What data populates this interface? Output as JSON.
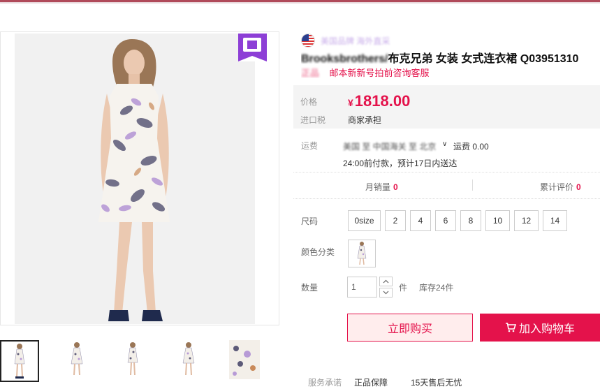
{
  "gallery": {
    "main_image_alt": "",
    "thumbnail_count": 5,
    "active_thumbnail": 0
  },
  "product": {
    "origin_text": "美国品牌 海外直采",
    "title_brand_blurred": "Brooksbrothers/",
    "title_rest": "布克兄弟 女装 女式连衣裙 Q03951310",
    "subtitle_blurred": "正品",
    "subtitle_rest": "邮本新新号拍前咨询客服"
  },
  "price": {
    "label": "价格",
    "currency": "¥",
    "value": "1818.00",
    "tax_label": "进口税",
    "tax_value": "商家承担"
  },
  "shipping": {
    "label": "运费",
    "from_text": "美国 至 中国海关 至 北京",
    "chevron": "∨",
    "fee_text": "运费 0.00",
    "note": "24:00前付款，预计17日内送达"
  },
  "stats": {
    "monthly_label": "月销量",
    "monthly_value": "0",
    "rating_label": "累计评价",
    "rating_value": "0"
  },
  "sizes": {
    "label": "尺码",
    "options": [
      "0size",
      "2",
      "4",
      "6",
      "8",
      "10",
      "12",
      "14"
    ]
  },
  "color": {
    "label": "颜色分类"
  },
  "quantity": {
    "label": "数量",
    "value": "1",
    "unit": "件",
    "stock": "库存24件"
  },
  "actions": {
    "buy_now": "立即购买",
    "add_cart": "加入购物车"
  },
  "service": {
    "label": "服务承诺",
    "item1": "正品保障",
    "item2": "15天售后无忧"
  },
  "colors": {
    "accent": "#e4124b",
    "badge": "#8d3fd6",
    "price_bg": "#f4f4f4"
  }
}
